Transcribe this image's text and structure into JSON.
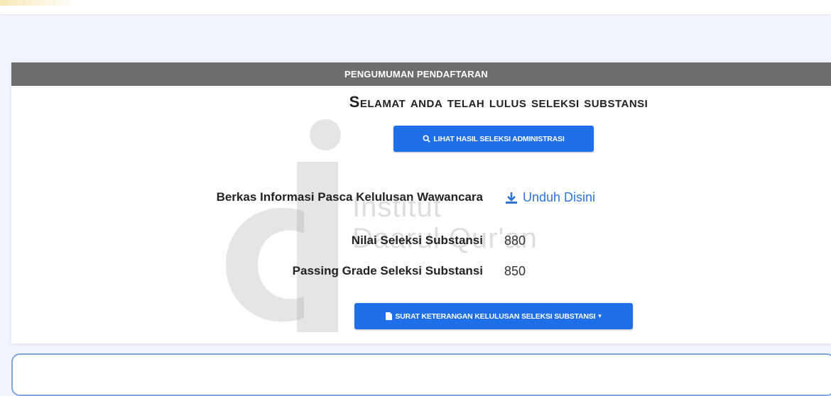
{
  "header": {
    "title": "PENGUMUMAN PENDAFTARAN"
  },
  "headline": "Selamat anda telah lulus seleksi substansi",
  "buttons": {
    "admin_result": {
      "label": "LIHAT HASIL SELEKSI ADMINISTRASI",
      "icon": "search-icon"
    },
    "certificate": {
      "label": "SURAT KETERANGAN KELULUSAN SELEKSI SUBSTANSI",
      "icon": "file-icon",
      "caret": "▾"
    }
  },
  "info": {
    "berkas_label": "Berkas Informasi Pasca Kelulusan Wawancara",
    "download_label": "Unduh Disini",
    "nilai_label": "Nilai Seleksi Substansi",
    "nilai_value": "880",
    "passing_label": "Passing Grade Seleksi Substansi",
    "passing_value": "850"
  },
  "watermark": {
    "line1": "Institut",
    "line2": "Daarul Qur'an"
  },
  "colors": {
    "page_bg": "#f1f4fb",
    "header_bg": "#6d6d6d",
    "button_blue": "#1f6fe8",
    "link_blue": "#2f74d6"
  }
}
